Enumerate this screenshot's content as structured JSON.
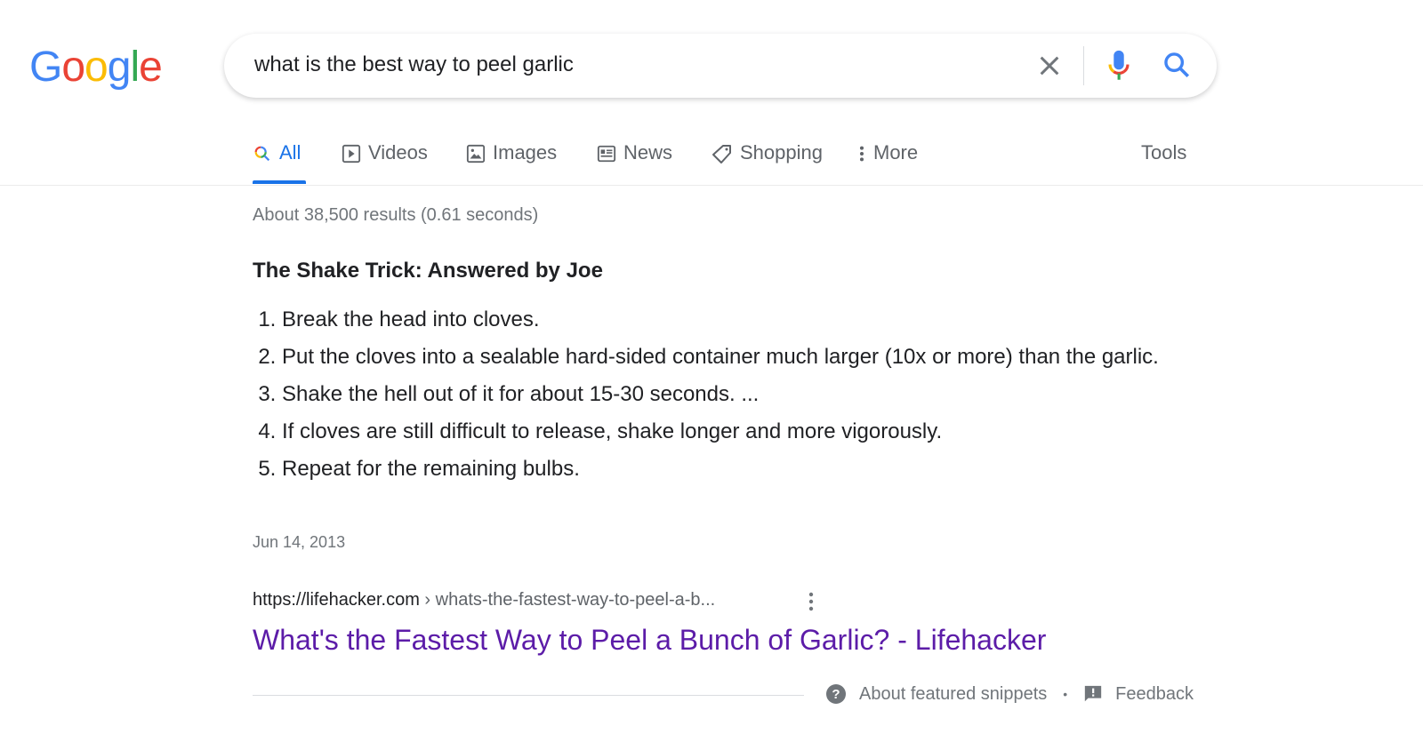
{
  "logo": {
    "letters": [
      "G",
      "o",
      "o",
      "g",
      "l",
      "e"
    ],
    "colors": [
      "#4285f4",
      "#ea4335",
      "#fbbc05",
      "#4285f4",
      "#34a853",
      "#ea4335"
    ]
  },
  "search": {
    "query": "what is the best way to peel garlic"
  },
  "tabs": [
    {
      "label": "All",
      "icon": "search-icon",
      "active": true
    },
    {
      "label": "Videos",
      "icon": "video-icon"
    },
    {
      "label": "Images",
      "icon": "image-icon"
    },
    {
      "label": "News",
      "icon": "news-icon"
    },
    {
      "label": "Shopping",
      "icon": "tag-icon"
    },
    {
      "label": "More",
      "icon": "more-vert-icon"
    }
  ],
  "tools_label": "Tools",
  "result_stats": "About 38,500 results (0.61 seconds)",
  "snippet": {
    "title": "The Shake Trick: Answered by Joe",
    "steps": [
      "Break the head into cloves.",
      "Put the cloves into a sealable hard-sided container much larger (10x or more) than the garlic.",
      "Shake the hell out of it for about 15-30 seconds. ...",
      "If cloves are still difficult to release, shake longer and more vigorously.",
      "Repeat for the remaining bulbs."
    ],
    "date": "Jun 14, 2013"
  },
  "result": {
    "domain": "https://lifehacker.com",
    "path": " › whats-the-fastest-way-to-peel-a-b...",
    "title": "What's the Fastest Way to Peel a Bunch of Garlic? - Lifehacker"
  },
  "footer": {
    "about": "About featured snippets",
    "separator": "•",
    "feedback": "Feedback"
  },
  "colors": {
    "accent": "#1a73e8",
    "visited_link": "#5c1ca8",
    "muted": "#70757a"
  }
}
